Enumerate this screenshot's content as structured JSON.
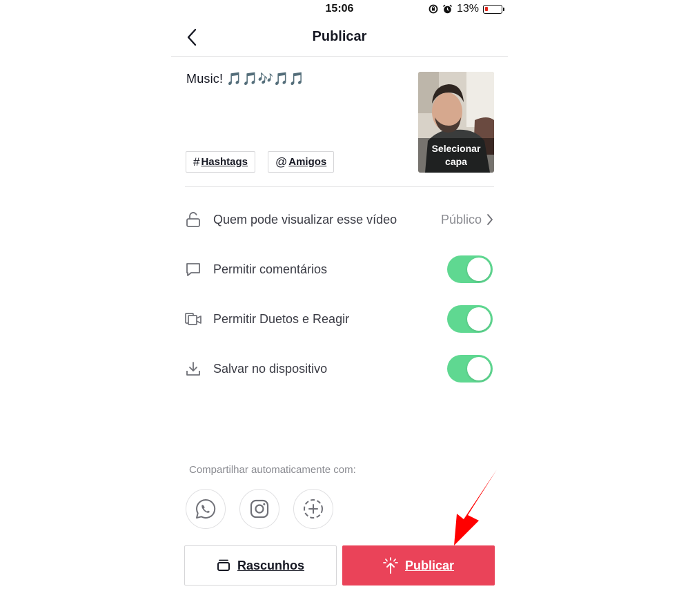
{
  "status_bar": {
    "time": "15:06",
    "battery_percent": "13%",
    "battery_level": 0.13,
    "icons": [
      "rotation-lock-icon",
      "alarm-icon",
      "battery-icon"
    ]
  },
  "header": {
    "title": "Publicar",
    "back_icon": "chevron-left-icon"
  },
  "caption": {
    "text": "Music! 🎵🎵🎶🎵🎵",
    "hashtags_symbol": "#",
    "hashtags_label": "Hashtags",
    "mentions_symbol": "@",
    "mentions_label": "Amigos"
  },
  "cover": {
    "label_line1": "Selecionar",
    "label_line2": "capa"
  },
  "settings": {
    "privacy": {
      "label": "Quem pode visualizar esse vídeo",
      "value": "Público",
      "icon": "unlock-icon"
    },
    "comments": {
      "label": "Permitir comentários",
      "enabled": true,
      "icon": "comment-icon"
    },
    "duet": {
      "label": "Permitir Duetos e Reagir",
      "enabled": true,
      "icon": "duet-icon"
    },
    "save": {
      "label": "Salvar no dispositivo",
      "enabled": true,
      "icon": "download-icon"
    }
  },
  "share": {
    "label": "Compartilhar automaticamente com:",
    "targets": [
      "whatsapp-icon",
      "instagram-icon",
      "add-share-icon"
    ]
  },
  "actions": {
    "drafts_label": "Rascunhos",
    "publish_label": "Publicar"
  },
  "colors": {
    "toggle_on": "#5fd891",
    "publish": "#ea4359",
    "annotation_arrow": "#ff0000"
  }
}
